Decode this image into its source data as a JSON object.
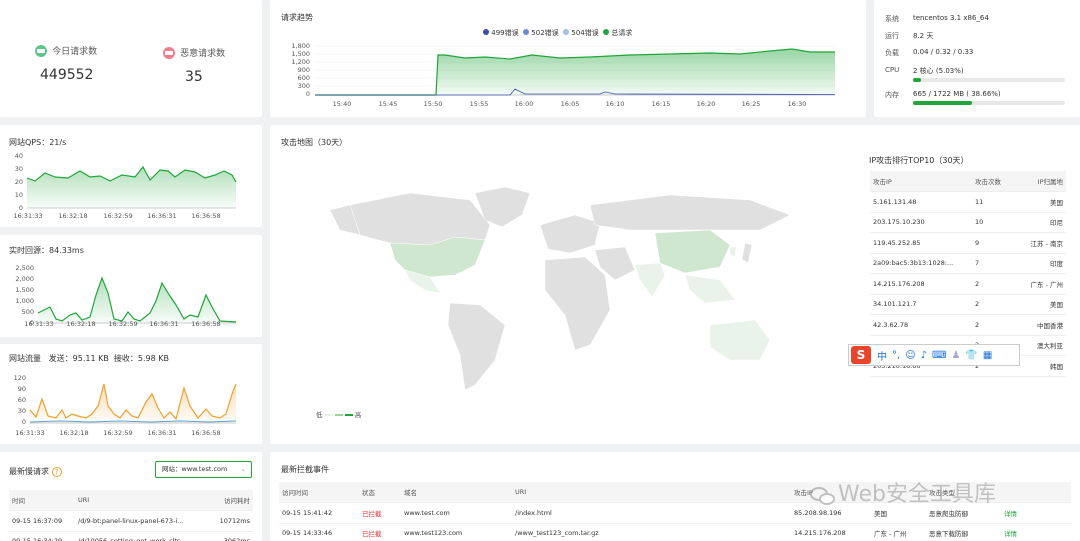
{
  "requests": {
    "today_label": "今日请求数",
    "today_value": "449552",
    "malicious_label": "恶意请求数",
    "malicious_value": "35"
  },
  "trend": {
    "title": "请求趋势",
    "legend": [
      {
        "name": "499错误",
        "color": "#3a4fb0"
      },
      {
        "name": "502错误",
        "color": "#6f88d6"
      },
      {
        "name": "504错误",
        "color": "#9fc0e8"
      },
      {
        "name": "总请求",
        "color": "#20a53a"
      }
    ],
    "y_ticks": [
      "1,800",
      "1,500",
      "1,200",
      "900",
      "600",
      "300",
      "0"
    ],
    "x_ticks": [
      "15:40",
      "15:45",
      "15:50",
      "15:55",
      "16:00",
      "16:05",
      "16:10",
      "16:15",
      "16:20",
      "16:25",
      "16:30"
    ]
  },
  "system": {
    "rows": [
      {
        "label": "系统",
        "value": "tencentos 3.1 x86_64"
      },
      {
        "label": "运行",
        "value": "8.2 天"
      },
      {
        "label": "负载",
        "value": "0.04 / 0.32 / 0.33"
      },
      {
        "label": "CPU",
        "value": "2 核心 (5.03%)",
        "percent": 5.03
      },
      {
        "label": "内存",
        "value": "665 / 1722 MB ( 38.66%)",
        "percent": 38.66
      }
    ]
  },
  "qps": {
    "title": "网站QPS：",
    "value": "21/s",
    "y_ticks": [
      "40",
      "30",
      "20",
      "10",
      "0"
    ],
    "x_ticks": [
      "16:31:33",
      "16:32:18",
      "16:32:59",
      "16:36:31",
      "16:36:58"
    ]
  },
  "latency": {
    "title": "实时回源：",
    "value": "84.33ms",
    "y_ticks": [
      "2,500",
      "2,000",
      "1,500",
      "1,000",
      "500",
      "0"
    ],
    "x_ticks": [
      "16:31:33",
      "16:32:18",
      "16:32:59",
      "16:36:31",
      "16:36:58"
    ]
  },
  "traffic": {
    "title": "网站流量",
    "send_label": "发送：",
    "send_value": "95.11 KB",
    "recv_label": "接收：",
    "recv_value": "5.98 KB",
    "y_ticks": [
      "120",
      "90",
      "60",
      "30",
      "0"
    ],
    "x_ticks": [
      "16:31:33",
      "16:32:18",
      "16:32:59",
      "16:36:31",
      "16:36:58"
    ]
  },
  "map": {
    "title": "攻击地图（30天）",
    "legend_low": "低",
    "legend_high": "高"
  },
  "top10": {
    "title": "IP攻击排行TOP10（30天）",
    "headers": [
      "攻击IP",
      "攻击次数",
      "IP归属地"
    ],
    "rows": [
      [
        "5.161.131.48",
        "11",
        "美国"
      ],
      [
        "203.175.10.230",
        "10",
        "印尼"
      ],
      [
        "119.45.252.85",
        "9",
        "江苏 - 南京"
      ],
      [
        "2a09:bac5:3b13:1028:...",
        "7",
        "印度"
      ],
      [
        "14.215.176.208",
        "2",
        "广东 - 广州"
      ],
      [
        "34.101.121.7",
        "2",
        "美国"
      ],
      [
        "42.3.62.78",
        "2",
        "中国香港"
      ],
      [
        "",
        "2",
        "澳大利亚"
      ],
      [
        "203.210.16.66",
        "2",
        "韩国"
      ]
    ]
  },
  "ime": {
    "logo": "S",
    "items": [
      "中",
      "°,",
      "☺",
      "♪",
      "⌨",
      "♟",
      "👕",
      "▦"
    ]
  },
  "slow": {
    "title": "最新慢请求",
    "site_label": "网站：",
    "site_value": "www.test.com",
    "headers": [
      "时间",
      "URI",
      "访问耗时"
    ],
    "rows": [
      [
        "09-15 16:37:09",
        "/d/9-bt:panel-linux-panel-673-i...",
        "10712ms"
      ],
      [
        "09-15 16:34:29",
        "/d/10056_setting_get_work_clts...",
        "3062ms"
      ]
    ]
  },
  "blocks": {
    "title": "最新拦截事件",
    "headers": [
      "访问时间",
      "状态",
      "域名",
      "URI",
      "攻击IP",
      "",
      "攻击类型",
      ""
    ],
    "rows": [
      [
        "09-15 15:41:42",
        "已拦截",
        "www.test.com",
        "/index.html",
        "85.208.98.196",
        "美国",
        "恶意爬虫防御",
        "详情"
      ],
      [
        "09-15 14:33:46",
        "已拦截",
        "www.test123.com",
        "/www_test123_com.tar.gz",
        "14.215.176.208",
        "广东 - 广州",
        "恶意下载防御",
        "详情"
      ]
    ]
  },
  "watermark": "Web安全工具库"
}
